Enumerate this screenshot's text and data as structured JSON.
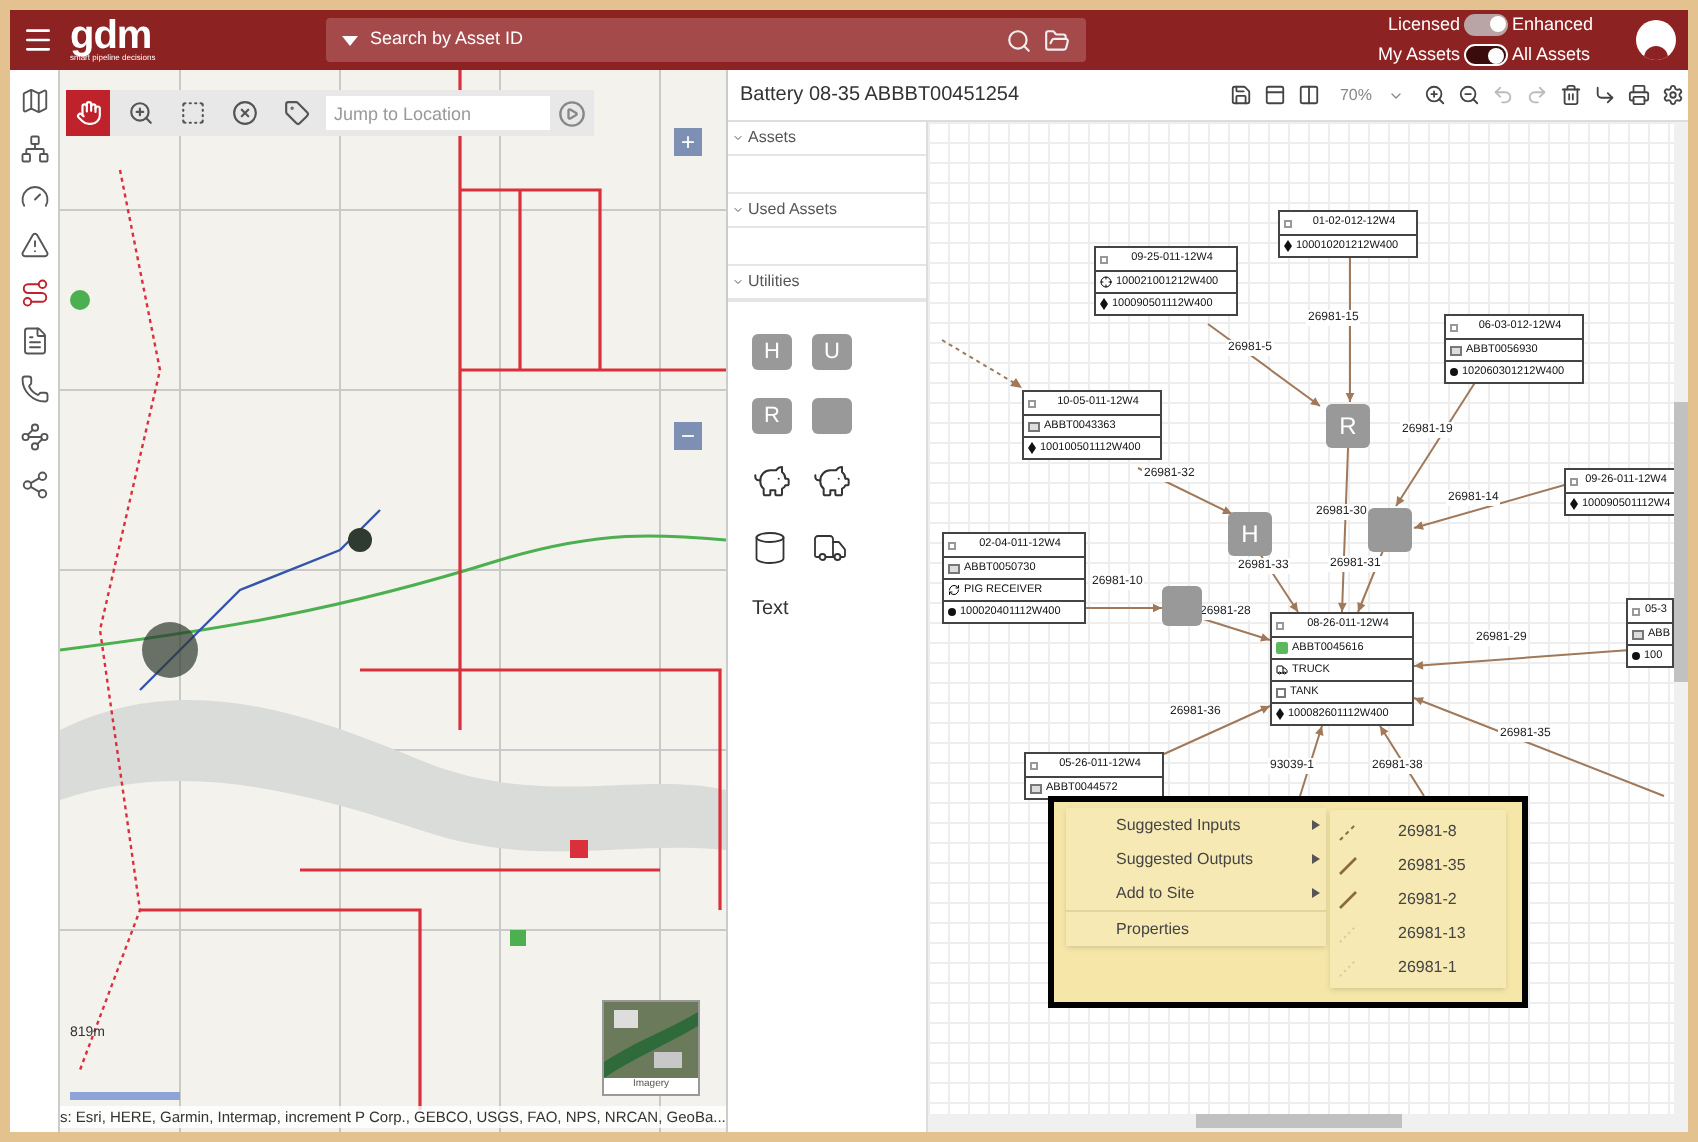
{
  "top_bar": {
    "logo": "gdm",
    "tagline": "smart pipeline decisions",
    "search": {
      "placeholder": "Search by Asset ID"
    },
    "toggles": [
      {
        "left": "Licensed",
        "right": "Enhanced",
        "on": true,
        "disabled": true
      },
      {
        "left": "My Assets",
        "right": "All Assets",
        "on": true,
        "disabled": false
      }
    ]
  },
  "sidebar": {
    "items": [
      {
        "selected": false
      },
      {
        "selected": false
      },
      {
        "selected": false
      },
      {
        "selected": false
      },
      {
        "selected": true
      },
      {
        "selected": false
      },
      {
        "selected": false
      },
      {
        "selected": false
      },
      {
        "selected": false
      }
    ]
  },
  "map": {
    "tools": [
      {
        "selected": true
      },
      {
        "selected": false
      },
      {
        "selected": false
      },
      {
        "selected": false
      },
      {
        "selected": false
      }
    ],
    "search": {
      "placeholder": "Jump to Location"
    },
    "zoom_in": "+",
    "zoom_out": "−",
    "scale": "819m",
    "basemap_label": "Imagery",
    "attribution": "s: Esri, HERE, Garmin, Intermap, increment P Corp., GEBCO, USGS, FAO, NPS, NRCAN, GeoBa..."
  },
  "diagram": {
    "title": "Battery 08-35 ABBBT00451254",
    "zoom": "70%",
    "toolbar": [
      {
        "disabled": false
      },
      {
        "disabled": false
      },
      {
        "disabled": false
      },
      {
        "disabled": false
      },
      {
        "disabled": false
      },
      {
        "disabled": true
      },
      {
        "disabled": true
      },
      {
        "disabled": false
      },
      {
        "disabled": false
      },
      {
        "disabled": false
      },
      {
        "disabled": false
      }
    ],
    "palette": {
      "sections": [
        {
          "label": "Assets",
          "expanded": true
        },
        {
          "label": "Used Assets",
          "expanded": true
        },
        {
          "label": "Utilities",
          "expanded": true
        }
      ],
      "utilities": [
        {
          "kind": "square",
          "label": "H"
        },
        {
          "kind": "square",
          "label": "U"
        },
        {
          "kind": "square",
          "label": "R"
        },
        {
          "kind": "square"
        },
        {
          "kind": "launcher"
        },
        {
          "kind": "receiver"
        },
        {
          "kind": "tank"
        },
        {
          "kind": "truck"
        },
        {
          "kind": "text",
          "label": "Text"
        }
      ]
    },
    "nodes": [
      {
        "rows": [
          {
            "kind": "header",
            "text": "01-02-012-12W4"
          },
          {
            "kind": "well",
            "text": "100010201212W400"
          }
        ]
      },
      {
        "rows": [
          {
            "kind": "header",
            "text": "09-25-011-12W4"
          },
          {
            "kind": "target",
            "text": "100021001212W400"
          },
          {
            "kind": "well",
            "text": "100090501112W400"
          }
        ]
      },
      {
        "rows": [
          {
            "kind": "header",
            "text": "06-03-012-12W4"
          },
          {
            "kind": "meter",
            "text": "ABBT0056930"
          },
          {
            "kind": "dot",
            "text": "102060301212W400"
          }
        ]
      },
      {
        "rows": [
          {
            "kind": "header",
            "text": "10-05-011-12W4"
          },
          {
            "kind": "meter",
            "text": "ABBT0043363"
          },
          {
            "kind": "well",
            "text": "100100501112W400"
          }
        ]
      },
      {
        "rows": [
          {
            "kind": "header",
            "text": "09-26-011-12W4"
          },
          {
            "kind": "well",
            "text": "100090501112W4"
          }
        ]
      },
      {
        "rows": [
          {
            "kind": "header",
            "text": "02-04-011-12W4"
          },
          {
            "kind": "meter",
            "text": "ABBT0050730"
          },
          {
            "kind": "pig",
            "text": "PIG RECEIVER"
          },
          {
            "kind": "dot",
            "text": "100020401112W400"
          }
        ]
      },
      {
        "rows": [
          {
            "kind": "header",
            "text": "08-26-011-12W4"
          },
          {
            "kind": "battery",
            "text": "ABBT0045616"
          },
          {
            "kind": "truck",
            "text": "TRUCK"
          },
          {
            "kind": "tank",
            "text": "TANK"
          },
          {
            "kind": "well",
            "text": "100082601112W400"
          }
        ]
      },
      {
        "rows": [
          {
            "kind": "header",
            "text": "05-3"
          },
          {
            "kind": "meter",
            "text": "ABB"
          },
          {
            "kind": "dot",
            "text": "100"
          }
        ]
      },
      {
        "rows": [
          {
            "kind": "header",
            "text": "05-26-011-12W4"
          },
          {
            "kind": "meter",
            "text": "ABBT0044572"
          }
        ]
      }
    ],
    "utility_nodes": [
      {
        "kind": "labeled",
        "label": "R"
      },
      {
        "kind": "labeled",
        "label": "H"
      },
      {
        "kind": "blank"
      },
      {
        "kind": "blank"
      }
    ],
    "edges": [
      {
        "label": "26981-15"
      },
      {
        "label": "26981-5"
      },
      {
        "label": "26981-19"
      },
      {
        "label": "26981-32"
      },
      {
        "label": "26981-30"
      },
      {
        "label": "26981-14"
      },
      {
        "label": "26981-33"
      },
      {
        "label": "26981-31"
      },
      {
        "label": "26981-10"
      },
      {
        "label": "26981-28"
      },
      {
        "label": "26981-29"
      },
      {
        "label": "26981-35"
      },
      {
        "label": "26981-36"
      },
      {
        "label": "93039-1"
      },
      {
        "label": "26981-38"
      }
    ],
    "context_menu": {
      "items": [
        {
          "label": "Suggested Inputs",
          "submenu": true
        },
        {
          "label": "Suggested Outputs",
          "submenu": true
        },
        {
          "label": "Add to Site",
          "submenu": true
        },
        {
          "label": "Properties",
          "submenu": false
        }
      ],
      "submenu": [
        {
          "label": "26981-8",
          "kind": "dashed"
        },
        {
          "label": "26981-35",
          "kind": "solid"
        },
        {
          "label": "26981-2",
          "kind": "solid"
        },
        {
          "label": "26981-13",
          "kind": "faint"
        },
        {
          "label": "26981-1",
          "kind": "faint"
        }
      ]
    }
  }
}
